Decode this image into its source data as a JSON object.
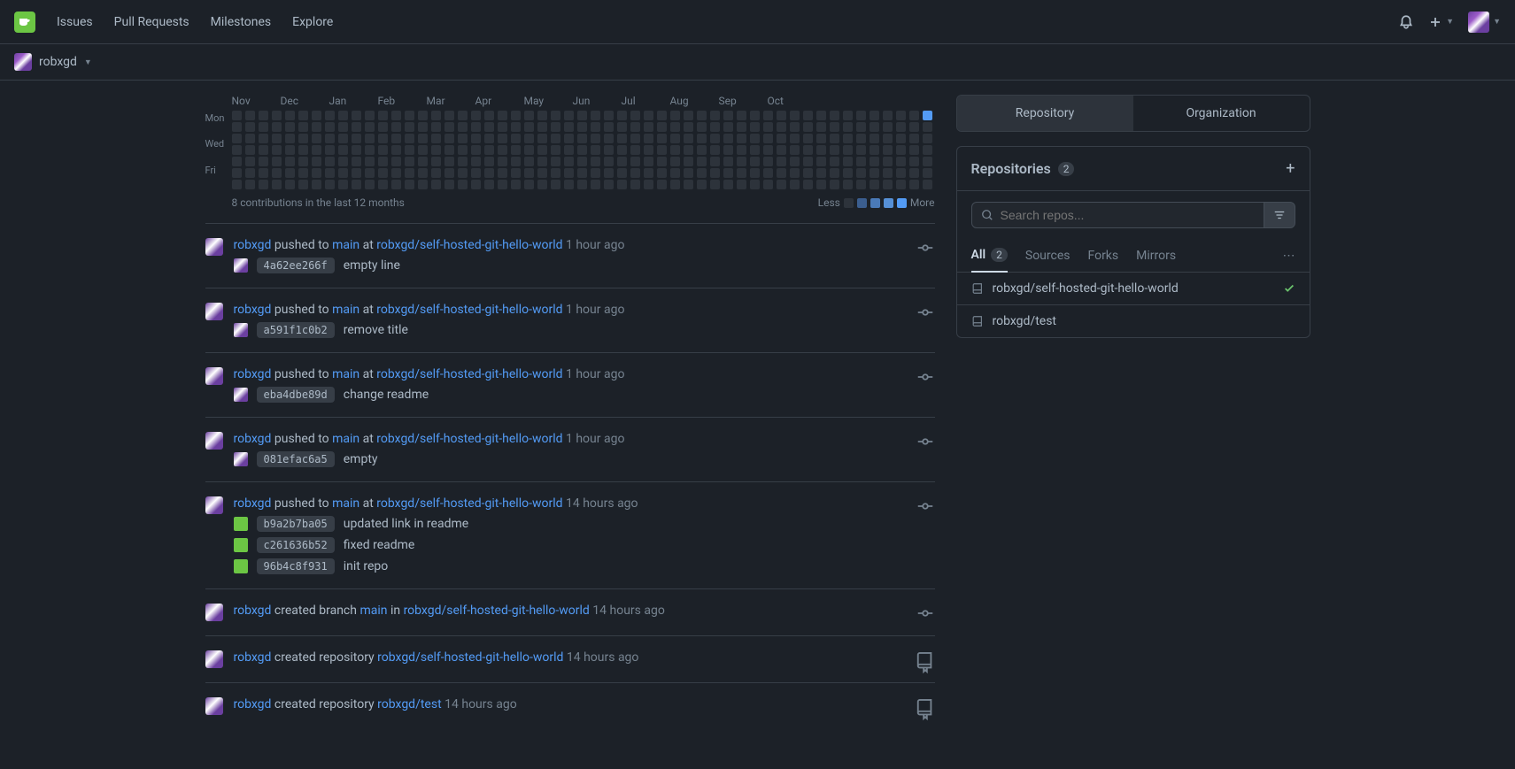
{
  "nav": {
    "items": [
      "Issues",
      "Pull Requests",
      "Milestones",
      "Explore"
    ]
  },
  "user": "robxgd",
  "heatmap": {
    "months": [
      "Nov",
      "Dec",
      "Jan",
      "Feb",
      "Mar",
      "Apr",
      "May",
      "Jun",
      "Jul",
      "Aug",
      "Sep",
      "Oct"
    ],
    "days": [
      "Mon",
      "Wed",
      "Fri"
    ],
    "summary": "8 contributions in the last 12 months",
    "legend_less": "Less",
    "legend_more": "More"
  },
  "feed": [
    {
      "type": "push",
      "user": "robxgd",
      "action": " pushed to ",
      "branch": "main",
      "at": " at ",
      "repo": "robxgd/self-hosted-git-hello-world",
      "time": "1 hour ago",
      "commits": [
        {
          "sha": "4a62ee266f",
          "msg": "empty line",
          "green": false
        }
      ]
    },
    {
      "type": "push",
      "user": "robxgd",
      "action": " pushed to ",
      "branch": "main",
      "at": " at ",
      "repo": "robxgd/self-hosted-git-hello-world",
      "time": "1 hour ago",
      "commits": [
        {
          "sha": "a591f1c0b2",
          "msg": "remove title",
          "green": false
        }
      ]
    },
    {
      "type": "push",
      "user": "robxgd",
      "action": " pushed to ",
      "branch": "main",
      "at": " at ",
      "repo": "robxgd/self-hosted-git-hello-world",
      "time": "1 hour ago",
      "commits": [
        {
          "sha": "eba4dbe89d",
          "msg": "change readme",
          "green": false
        }
      ]
    },
    {
      "type": "push",
      "user": "robxgd",
      "action": " pushed to ",
      "branch": "main",
      "at": " at ",
      "repo": "robxgd/self-hosted-git-hello-world",
      "time": "1 hour ago",
      "commits": [
        {
          "sha": "081efac6a5",
          "msg": "empty",
          "green": false
        }
      ]
    },
    {
      "type": "push",
      "user": "robxgd",
      "action": " pushed to ",
      "branch": "main",
      "at": " at ",
      "repo": "robxgd/self-hosted-git-hello-world",
      "time": "14 hours ago",
      "commits": [
        {
          "sha": "b9a2b7ba05",
          "msg": "updated link in readme",
          "green": true
        },
        {
          "sha": "c261636b52",
          "msg": "fixed readme",
          "green": true
        },
        {
          "sha": "96b4c8f931",
          "msg": "init repo",
          "green": true
        }
      ]
    },
    {
      "type": "branch",
      "user": "robxgd",
      "action": " created branch ",
      "branch": "main",
      "in": " in ",
      "repo": "robxgd/self-hosted-git-hello-world",
      "time": "14 hours ago"
    },
    {
      "type": "repo",
      "user": "robxgd",
      "action": " created repository ",
      "repo": "robxgd/self-hosted-git-hello-world",
      "time": "14 hours ago"
    },
    {
      "type": "repo",
      "user": "robxgd",
      "action": " created repository ",
      "repo": "robxgd/test",
      "time": "14 hours ago"
    }
  ],
  "sidebar": {
    "tabs": {
      "repository": "Repository",
      "organization": "Organization"
    },
    "repos_header": "Repositories",
    "repos_count": "2",
    "search_placeholder": "Search repos...",
    "repo_tabs": {
      "all": "All",
      "all_count": "2",
      "sources": "Sources",
      "forks": "Forks",
      "mirrors": "Mirrors"
    },
    "repos": [
      {
        "name": "robxgd/self-hosted-git-hello-world",
        "checked": true
      },
      {
        "name": "robxgd/test",
        "checked": false
      }
    ]
  }
}
